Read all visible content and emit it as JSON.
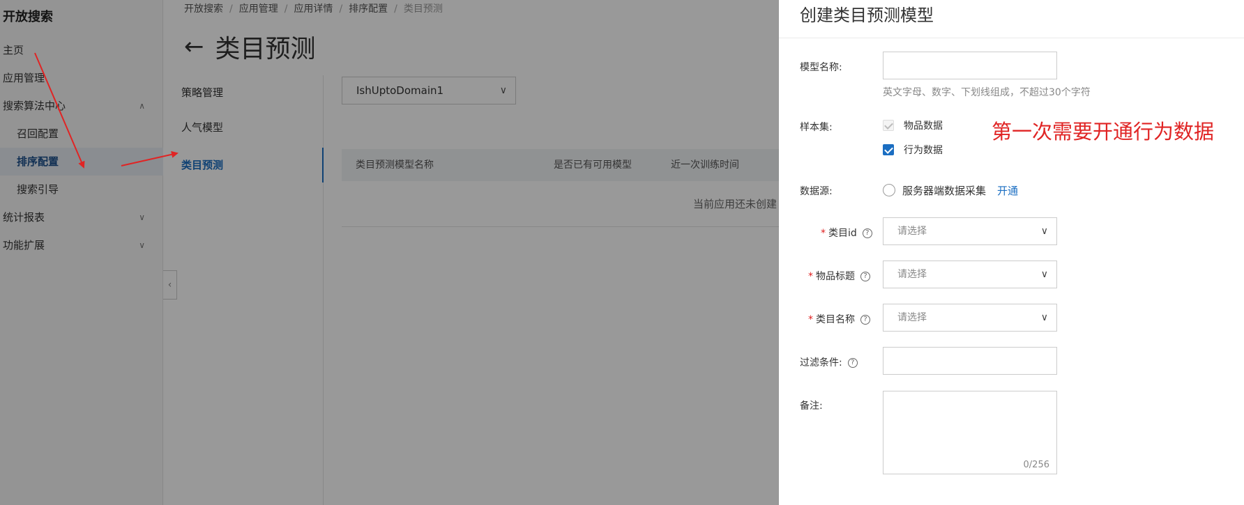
{
  "sidebar": {
    "brand": "开放搜索",
    "items": [
      {
        "label": "主页"
      },
      {
        "label": "应用管理"
      },
      {
        "label": "搜索算法中心",
        "chevron": "∧"
      },
      {
        "label": "召回配置"
      },
      {
        "label": "排序配置"
      },
      {
        "label": "搜索引导"
      },
      {
        "label": "统计报表",
        "chevron": "∨"
      },
      {
        "label": "功能扩展",
        "chevron": "∨"
      }
    ]
  },
  "breadcrumb": [
    "开放搜索",
    "应用管理",
    "应用详情",
    "排序配置",
    "类目预测"
  ],
  "breadcrumb_sep": "/",
  "page": {
    "back_icon": "←",
    "title": "类目预测"
  },
  "strategy_nav": [
    {
      "label": "策略管理"
    },
    {
      "label": "人气模型"
    },
    {
      "label": "类目预测"
    }
  ],
  "domain_select": {
    "value": "IshUptoDomain1"
  },
  "table": {
    "columns": [
      "类目预测模型名称",
      "是否已有可用模型",
      "近一次训练时间"
    ],
    "empty_text": "当前应用还未创建"
  },
  "drawer": {
    "title": "创建类目预测模型",
    "model_name": {
      "label": "模型名称:",
      "value": "",
      "hint": "英文字母、数字、下划线组成，不超过30个字符"
    },
    "sample_set": {
      "label": "样本集:",
      "options": [
        {
          "label": "物品数据",
          "checked": true,
          "disabled": true
        },
        {
          "label": "行为数据",
          "checked": true,
          "disabled": false
        }
      ]
    },
    "data_source": {
      "label": "数据源:",
      "option": "服务器端数据采集",
      "link": "开通"
    },
    "category_id": {
      "label": "类目id",
      "required_mark": "*",
      "placeholder": "请选择"
    },
    "item_title": {
      "label": "物品标题",
      "required_mark": "*",
      "placeholder": "请选择"
    },
    "category_name": {
      "label": "类目名称",
      "required_mark": "*",
      "placeholder": "请选择"
    },
    "filter": {
      "label": "过滤条件:",
      "value": ""
    },
    "remark": {
      "label": "备注:",
      "counter": "0/256"
    }
  },
  "icons": {
    "help": "?",
    "chevron_down": "∨",
    "collapse": "‹"
  },
  "annotation": {
    "text": "第一次需要开通行为数据",
    "color": "#e02424"
  },
  "colors": {
    "accent": "#1b6ec2",
    "required": "#e02020",
    "overlay": "rgba(0,0,0,0.4)"
  }
}
